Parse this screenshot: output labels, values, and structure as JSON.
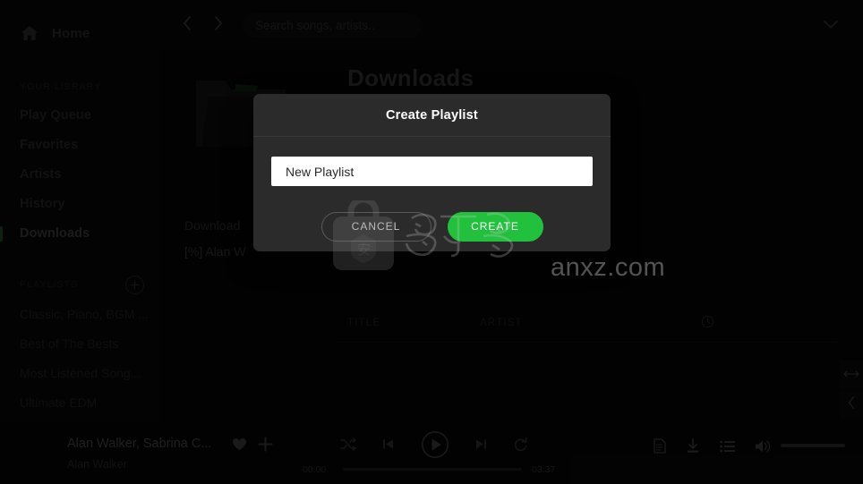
{
  "colors": {
    "accent_green": "#22c13d",
    "sidebar_bg": "#070707",
    "main_bg": "#050505",
    "modal_bg": "#2b2b2b",
    "input_bg": "#ffffff"
  },
  "sidebar": {
    "home": {
      "label": "Home",
      "icon": "home-icon"
    },
    "library_heading": "YOUR LIBRARY",
    "library_items": [
      {
        "label": "Play Queue",
        "active": false
      },
      {
        "label": "Favorites",
        "active": false
      },
      {
        "label": "Artists",
        "active": false
      },
      {
        "label": "History",
        "active": false
      },
      {
        "label": "Downloads",
        "active": true
      }
    ],
    "playlists_heading": "PLAYLISTS",
    "add_playlist_icon": "plus-circle-icon",
    "playlists": [
      {
        "label": "Classic, Piano, BGM ..."
      },
      {
        "label": "Best of The Bests"
      },
      {
        "label": "Most Listened Song..."
      },
      {
        "label": "Ultimate EDM"
      }
    ]
  },
  "topbar": {
    "back_icon": "chevron-left-icon",
    "forward_icon": "chevron-right-icon",
    "search": {
      "placeholder": "Search songs, artists..",
      "value": ""
    },
    "account_icon": "chevron-down-icon"
  },
  "main": {
    "page_title": "Downloads",
    "cover_icon": "folder-icon",
    "meta_line_1": "Download",
    "meta_line_2": "[%] Alan W",
    "table": {
      "columns": [
        "TITLE",
        "ARTIST"
      ],
      "duration_icon": "clock-icon",
      "rows": []
    },
    "edge_buttons": [
      {
        "icon": "resize-horizontal-icon"
      },
      {
        "icon": "chevron-left-icon"
      }
    ]
  },
  "player": {
    "track_title": "Alan Walker, Sabrina C...",
    "track_artist": "Alan Walker",
    "favorite_icon": "heart-icon",
    "add_icon": "plus-icon",
    "transport": [
      {
        "icon": "shuffle-icon"
      },
      {
        "icon": "previous-icon"
      },
      {
        "icon": "play-icon"
      },
      {
        "icon": "next-icon"
      },
      {
        "icon": "repeat-icon"
      }
    ],
    "time_elapsed": "00:00",
    "time_total": "03:37",
    "right_controls": [
      {
        "icon": "lyrics-icon"
      },
      {
        "icon": "download-icon"
      },
      {
        "icon": "queue-list-icon"
      },
      {
        "icon": "volume-icon"
      }
    ]
  },
  "modal": {
    "title": "Create Playlist",
    "input": {
      "value": "New Playlist",
      "placeholder": "New Playlist"
    },
    "cancel_label": "CANCEL",
    "create_label": "CREATE"
  },
  "watermark": {
    "logo_icon": "anxz-logo-icon",
    "text": "anxz.com"
  }
}
